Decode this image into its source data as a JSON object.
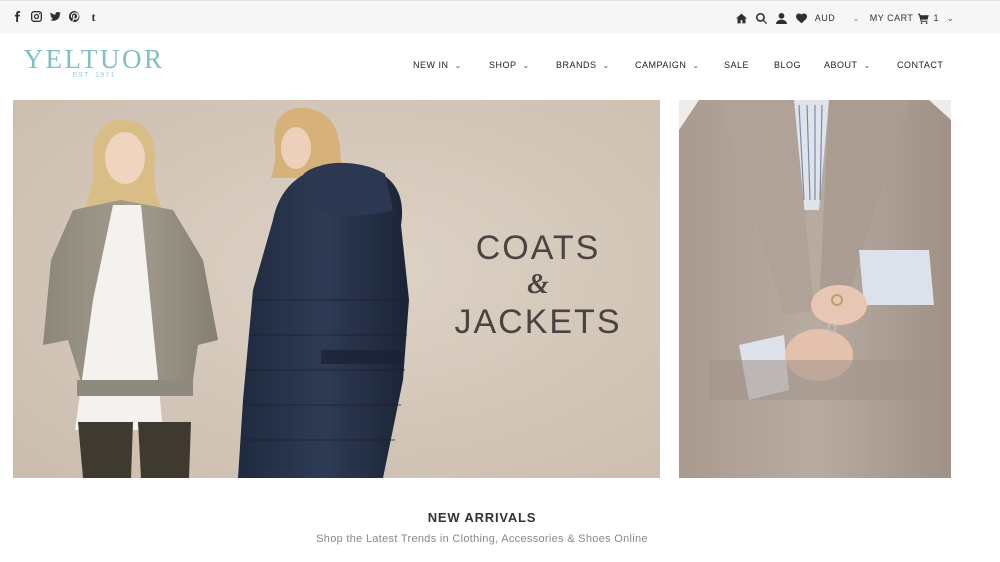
{
  "topbar": {
    "social": [
      "facebook-icon",
      "instagram-icon",
      "twitter-icon",
      "pinterest-icon",
      "tumblr-icon"
    ],
    "tumblr_glyph": "t",
    "currency": "AUD",
    "cart_label": "MY CART",
    "cart_count": "1"
  },
  "brand": {
    "name": "YELTUOR",
    "est": "EST. 1971",
    "color": "#7fbfc5"
  },
  "nav": {
    "items": [
      {
        "label": "NEW IN",
        "dropdown": true
      },
      {
        "label": "SHOP",
        "dropdown": true
      },
      {
        "label": "BRANDS",
        "dropdown": true
      },
      {
        "label": "CAMPAIGN",
        "dropdown": true
      },
      {
        "label": "SALE",
        "dropdown": false
      },
      {
        "label": "BLOG",
        "dropdown": false
      },
      {
        "label": "ABOUT",
        "dropdown": true
      },
      {
        "label": "CONTACT",
        "dropdown": false
      }
    ]
  },
  "hero": {
    "line1": "COATS",
    "line2": "&",
    "line3": "JACKETS"
  },
  "section": {
    "title": "NEW ARRIVALS",
    "subtitle": "Shop the Latest Trends in Clothing, Accessories & Shoes Online"
  }
}
